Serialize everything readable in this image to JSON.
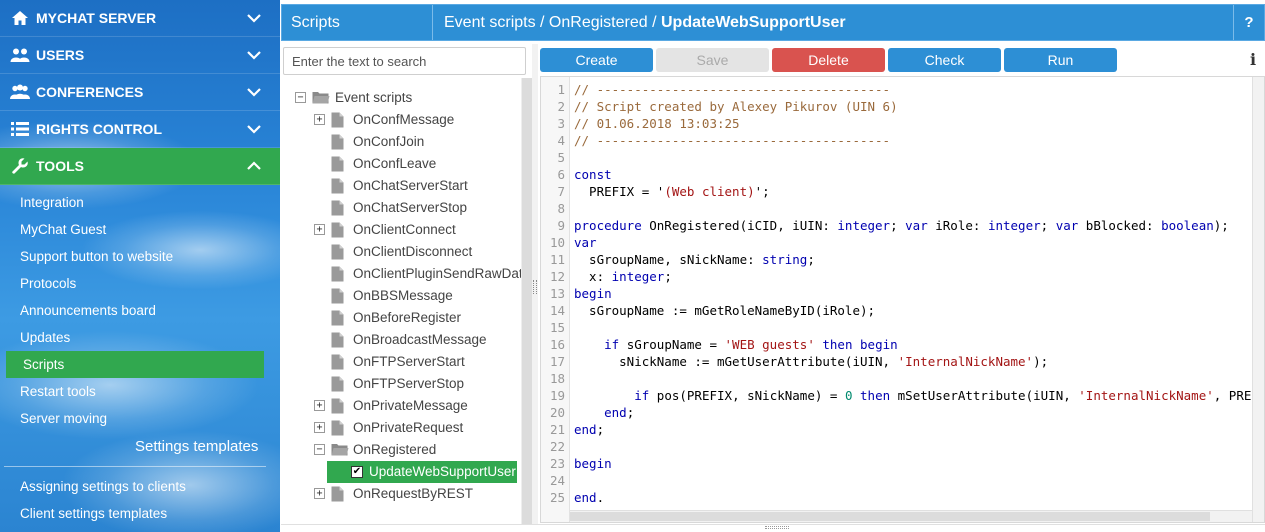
{
  "sidebar": {
    "main": [
      {
        "label": "MYCHAT SERVER",
        "icon": "home-icon"
      },
      {
        "label": "USERS",
        "icon": "users-icon"
      },
      {
        "label": "CONFERENCES",
        "icon": "conferences-icon"
      },
      {
        "label": "RIGHTS CONTROL",
        "icon": "list-icon"
      },
      {
        "label": "TOOLS",
        "icon": "wrench-icon"
      }
    ],
    "tools_items": [
      "Integration",
      "MyChat Guest",
      "Support button to website",
      "Protocols",
      "Announcements board",
      "Updates",
      "Scripts",
      "Restart tools",
      "Server moving"
    ],
    "settings_header": "Settings templates",
    "settings_items": [
      "Assigning settings to clients",
      "Client settings templates"
    ],
    "active_color": "#31a84f"
  },
  "header": {
    "section": "Scripts",
    "path": "Event scripts / OnRegistered / ",
    "current": "UpdateWebSupportUser",
    "help": "?"
  },
  "search": {
    "placeholder": "Enter the text to search"
  },
  "tree": [
    {
      "label": "Event scripts",
      "expand": "−",
      "type": "folder",
      "level": 0
    },
    {
      "label": "OnConfMessage",
      "expand": "+",
      "type": "file",
      "level": 1
    },
    {
      "label": "OnConfJoin",
      "expand": "",
      "type": "file",
      "level": 1
    },
    {
      "label": "OnConfLeave",
      "expand": "",
      "type": "file",
      "level": 1
    },
    {
      "label": "OnChatServerStart",
      "expand": "",
      "type": "file",
      "level": 1
    },
    {
      "label": "OnChatServerStop",
      "expand": "",
      "type": "file",
      "level": 1
    },
    {
      "label": "OnClientConnect",
      "expand": "+",
      "type": "file",
      "level": 1
    },
    {
      "label": "OnClientDisconnect",
      "expand": "",
      "type": "file",
      "level": 1
    },
    {
      "label": "OnClientPluginSendRawDat",
      "expand": "",
      "type": "file",
      "level": 1
    },
    {
      "label": "OnBBSMessage",
      "expand": "",
      "type": "file",
      "level": 1
    },
    {
      "label": "OnBeforeRegister",
      "expand": "",
      "type": "file",
      "level": 1
    },
    {
      "label": "OnBroadcastMessage",
      "expand": "",
      "type": "file",
      "level": 1
    },
    {
      "label": "OnFTPServerStart",
      "expand": "",
      "type": "file",
      "level": 1
    },
    {
      "label": "OnFTPServerStop",
      "expand": "",
      "type": "file",
      "level": 1
    },
    {
      "label": "OnPrivateMessage",
      "expand": "+",
      "type": "file",
      "level": 1
    },
    {
      "label": "OnPrivateRequest",
      "expand": "+",
      "type": "file",
      "level": 1
    },
    {
      "label": "OnRegistered",
      "expand": "−",
      "type": "folder",
      "level": 1
    },
    {
      "label": "UpdateWebSupportUser",
      "expand": "",
      "type": "script",
      "level": 2,
      "selected": true
    },
    {
      "label": "OnRequestByREST",
      "expand": "+",
      "type": "file",
      "level": 1
    }
  ],
  "toolbar": {
    "create": "Create",
    "save": "Save",
    "delete": "Delete",
    "check": "Check",
    "run": "Run",
    "info": "i"
  },
  "editor": {
    "lines": [
      [
        [
          "c-comment",
          "// ---------------------------------------"
        ]
      ],
      [
        [
          "c-comment",
          "// Script created by Alexey Pikurov (UIN 6)"
        ]
      ],
      [
        [
          "c-comment",
          "// 01.06.2018 13:03:25"
        ]
      ],
      [
        [
          "c-comment",
          "// ---------------------------------------"
        ]
      ],
      [],
      [
        [
          "c-kw",
          "const"
        ]
      ],
      [
        [
          "c-plain",
          "  PREFIX = '"
        ],
        [
          "c-str",
          "(Web client)"
        ],
        [
          "c-plain",
          "';"
        ]
      ],
      [],
      [
        [
          "c-kw",
          "procedure"
        ],
        [
          "c-plain",
          " OnRegistered(iCID, iUIN: "
        ],
        [
          "c-kw",
          "integer"
        ],
        [
          "c-plain",
          "; "
        ],
        [
          "c-kw",
          "var"
        ],
        [
          "c-plain",
          " iRole: "
        ],
        [
          "c-kw",
          "integer"
        ],
        [
          "c-plain",
          "; "
        ],
        [
          "c-kw",
          "var"
        ],
        [
          "c-plain",
          " bBlocked: "
        ],
        [
          "c-kw",
          "boolean"
        ],
        [
          "c-plain",
          ");"
        ]
      ],
      [
        [
          "c-kw",
          "var"
        ]
      ],
      [
        [
          "c-plain",
          "  sGroupName, sNickName: "
        ],
        [
          "c-kw",
          "string"
        ],
        [
          "c-plain",
          ";"
        ]
      ],
      [
        [
          "c-plain",
          "  x: "
        ],
        [
          "c-kw",
          "integer"
        ],
        [
          "c-plain",
          ";"
        ]
      ],
      [
        [
          "c-kw",
          "begin"
        ]
      ],
      [
        [
          "c-plain",
          "  sGroupName := mGetRoleNameByID(iRole);"
        ]
      ],
      [],
      [
        [
          "c-plain",
          "    "
        ],
        [
          "c-kw",
          "if"
        ],
        [
          "c-plain",
          " sGroupName = "
        ],
        [
          "c-str",
          "'WEB guests'"
        ],
        [
          "c-plain",
          " "
        ],
        [
          "c-kw",
          "then"
        ],
        [
          "c-plain",
          " "
        ],
        [
          "c-kw",
          "begin"
        ]
      ],
      [
        [
          "c-plain",
          "      sNickName := mGetUserAttribute(iUIN, "
        ],
        [
          "c-str",
          "'InternalNickName'"
        ],
        [
          "c-plain",
          ");"
        ]
      ],
      [],
      [
        [
          "c-plain",
          "        "
        ],
        [
          "c-kw",
          "if"
        ],
        [
          "c-plain",
          " pos(PREFIX, sNickName) = "
        ],
        [
          "c-num",
          "0"
        ],
        [
          "c-plain",
          " "
        ],
        [
          "c-kw",
          "then"
        ],
        [
          "c-plain",
          " mSetUserAttribute(iUIN, "
        ],
        [
          "c-str",
          "'InternalNickName'"
        ],
        [
          "c-plain",
          ", PREFIX + sNickName);"
        ]
      ],
      [
        [
          "c-plain",
          "    "
        ],
        [
          "c-kw",
          "end"
        ],
        [
          "c-plain",
          ";"
        ]
      ],
      [
        [
          "c-kw",
          "end"
        ],
        [
          "c-plain",
          ";"
        ]
      ],
      [],
      [
        [
          "c-kw",
          "begin"
        ]
      ],
      [],
      [
        [
          "c-kw",
          "end"
        ],
        [
          "c-plain",
          "."
        ]
      ]
    ]
  }
}
